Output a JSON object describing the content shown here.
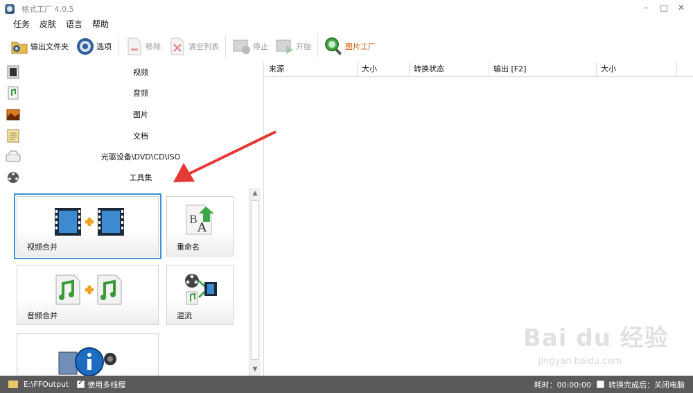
{
  "window": {
    "title": "格式工厂 4.0.5",
    "controls": [
      "minimize",
      "maximize",
      "close"
    ]
  },
  "menu": [
    "任务",
    "皮肤",
    "语言",
    "帮助"
  ],
  "toolbar": {
    "output_folder": "输出文件夹",
    "options": "选项",
    "remove": "移除",
    "clear_list": "清空列表",
    "stop": "停止",
    "start": "开始",
    "image_factory": "图片工厂"
  },
  "categories": [
    {
      "label": "视频",
      "icon": "video-icon"
    },
    {
      "label": "音频",
      "icon": "audio-icon"
    },
    {
      "label": "图片",
      "icon": "picture-icon"
    },
    {
      "label": "文档",
      "icon": "document-icon"
    },
    {
      "label": "光驱设备\\DVD\\CD\\ISO",
      "icon": "disc-drive-icon"
    },
    {
      "label": "工具集",
      "icon": "tools-icon"
    }
  ],
  "tools": {
    "video_merge": "视频合并",
    "rename": "重命名",
    "audio_merge": "音频合并",
    "mux": "混流"
  },
  "file_list": {
    "columns": [
      "来源",
      "大小",
      "转换状态",
      "输出 [F2]",
      "大小"
    ]
  },
  "statusbar": {
    "output_path": "E:\\FFOutput",
    "multithread_label": "使用多线程",
    "multithread_checked": true,
    "elapsed": "耗时：00:00:00",
    "after_convert": "转换完成后：关闭电脑",
    "after_convert_checked": false
  },
  "watermark": {
    "logo": "Bai du 经验",
    "url": "jingyan.baidu.com"
  },
  "colors": {
    "selection": "#3b8fd8",
    "annotation_arrow": "#e53935",
    "image_factory_label": "#d35400",
    "statusbar_bg": "#5a5a5a"
  }
}
